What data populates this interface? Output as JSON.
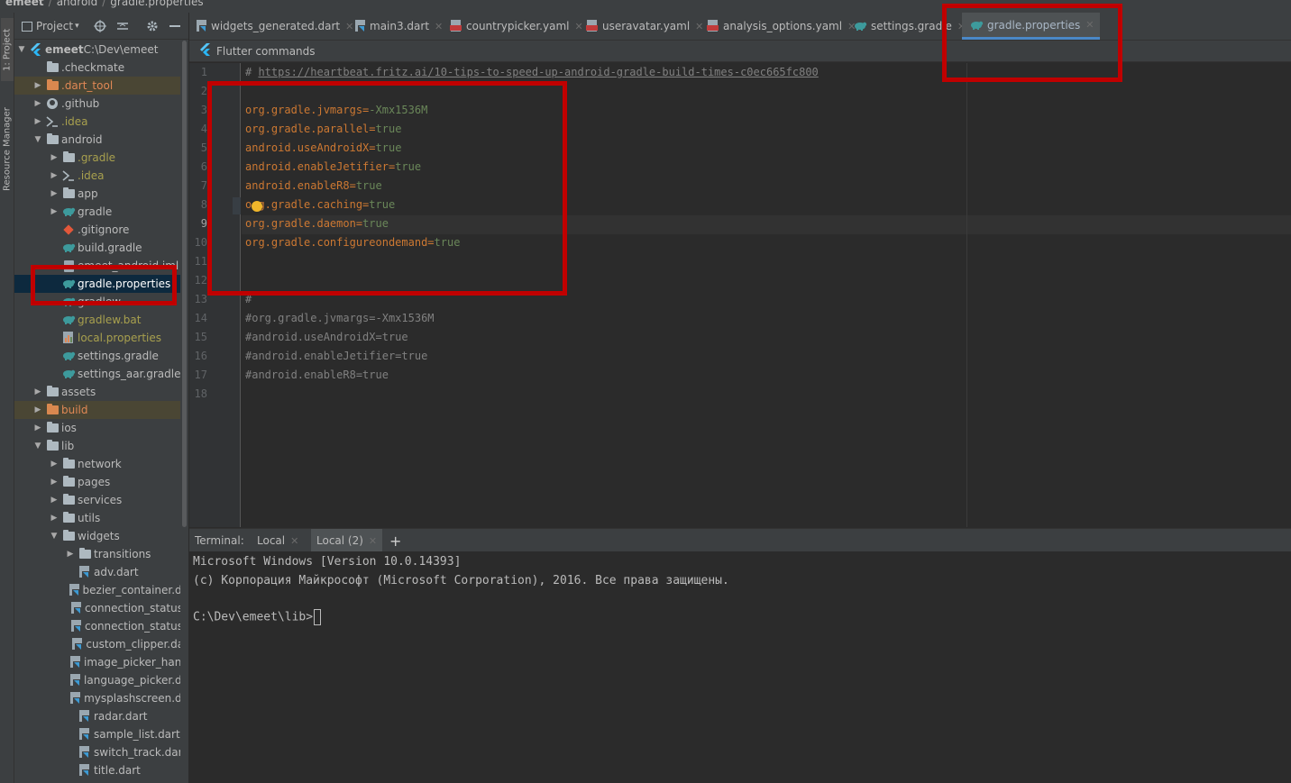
{
  "breadcrumb": [
    "emeet",
    "android",
    "gradle.properties"
  ],
  "tool_strip": {
    "project": "1: Project",
    "resource_manager": "Resource Manager"
  },
  "project_toolbar": {
    "view_label": "Project"
  },
  "tree": [
    {
      "label": "emeet",
      "path": "C:\\Dev\\emeet",
      "depth": 0,
      "arrow": "down",
      "icon": "flutter-icon",
      "bold": true
    },
    {
      "label": ".checkmate",
      "depth": 1,
      "arrow": "",
      "icon": "folder-icon"
    },
    {
      "label": ".dart_tool",
      "depth": 1,
      "arrow": "right",
      "icon": "folder-orange-icon",
      "color": "orange",
      "hl": true
    },
    {
      "label": ".github",
      "depth": 1,
      "arrow": "right",
      "icon": "github-icon"
    },
    {
      "label": ".idea",
      "depth": 1,
      "arrow": "right",
      "icon": "idea-icon",
      "color": "olive"
    },
    {
      "label": "android",
      "depth": 1,
      "arrow": "down",
      "icon": "folder-icon"
    },
    {
      "label": ".gradle",
      "depth": 2,
      "arrow": "right",
      "icon": "folder-icon",
      "color": "olive"
    },
    {
      "label": ".idea",
      "depth": 2,
      "arrow": "right",
      "icon": "idea-icon",
      "color": "olive"
    },
    {
      "label": "app",
      "depth": 2,
      "arrow": "right",
      "icon": "folder-icon"
    },
    {
      "label": "gradle",
      "depth": 2,
      "arrow": "right",
      "icon": "gradle-icon"
    },
    {
      "label": ".gitignore",
      "depth": 2,
      "arrow": "",
      "icon": "git-icon"
    },
    {
      "label": "build.gradle",
      "depth": 2,
      "arrow": "",
      "icon": "gradle-icon"
    },
    {
      "label": "emeet_android.iml",
      "depth": 2,
      "arrow": "",
      "icon": "iml-icon"
    },
    {
      "label": "gradle.properties",
      "depth": 2,
      "arrow": "",
      "icon": "gradle-icon",
      "selected": true
    },
    {
      "label": "gradlew",
      "depth": 2,
      "arrow": "",
      "icon": "gradle-icon"
    },
    {
      "label": "gradlew.bat",
      "depth": 2,
      "arrow": "",
      "icon": "gradle-icon",
      "color": "olive"
    },
    {
      "label": "local.properties",
      "depth": 2,
      "arrow": "",
      "icon": "properties-icon",
      "color": "olive"
    },
    {
      "label": "settings.gradle",
      "depth": 2,
      "arrow": "",
      "icon": "gradle-icon"
    },
    {
      "label": "settings_aar.gradle",
      "depth": 2,
      "arrow": "",
      "icon": "gradle-icon"
    },
    {
      "label": "assets",
      "depth": 1,
      "arrow": "right",
      "icon": "folder-icon"
    },
    {
      "label": "build",
      "depth": 1,
      "arrow": "right",
      "icon": "folder-orange-icon",
      "color": "orange",
      "hl": true
    },
    {
      "label": "ios",
      "depth": 1,
      "arrow": "right",
      "icon": "folder-icon"
    },
    {
      "label": "lib",
      "depth": 1,
      "arrow": "down",
      "icon": "folder-icon"
    },
    {
      "label": "network",
      "depth": 2,
      "arrow": "right",
      "icon": "folder-icon"
    },
    {
      "label": "pages",
      "depth": 2,
      "arrow": "right",
      "icon": "folder-icon"
    },
    {
      "label": "services",
      "depth": 2,
      "arrow": "right",
      "icon": "folder-icon"
    },
    {
      "label": "utils",
      "depth": 2,
      "arrow": "right",
      "icon": "folder-icon"
    },
    {
      "label": "widgets",
      "depth": 2,
      "arrow": "down",
      "icon": "folder-icon"
    },
    {
      "label": "transitions",
      "depth": 3,
      "arrow": "right",
      "icon": "folder-icon"
    },
    {
      "label": "adv.dart",
      "depth": 3,
      "arrow": "",
      "icon": "dart-file-icon"
    },
    {
      "label": "bezier_container.da",
      "depth": 3,
      "arrow": "",
      "icon": "dart-file-icon"
    },
    {
      "label": "connection_status_",
      "depth": 3,
      "arrow": "",
      "icon": "dart-file-icon"
    },
    {
      "label": "connection_status_",
      "depth": 3,
      "arrow": "",
      "icon": "dart-file-icon"
    },
    {
      "label": "custom_clipper.dar",
      "depth": 3,
      "arrow": "",
      "icon": "dart-file-icon"
    },
    {
      "label": "image_picker_hand",
      "depth": 3,
      "arrow": "",
      "icon": "dart-file-icon"
    },
    {
      "label": "language_picker.da",
      "depth": 3,
      "arrow": "",
      "icon": "dart-file-icon"
    },
    {
      "label": "mysplashscreen.da",
      "depth": 3,
      "arrow": "",
      "icon": "dart-file-icon"
    },
    {
      "label": "radar.dart",
      "depth": 3,
      "arrow": "",
      "icon": "dart-file-icon"
    },
    {
      "label": "sample_list.dart",
      "depth": 3,
      "arrow": "",
      "icon": "dart-file-icon"
    },
    {
      "label": "switch_track.dart",
      "depth": 3,
      "arrow": "",
      "icon": "dart-file-icon"
    },
    {
      "label": "title.dart",
      "depth": 3,
      "arrow": "",
      "icon": "dart-file-icon"
    }
  ],
  "editor_tabs": [
    {
      "label": "widgets_generated.dart",
      "icon": "dart-file-icon"
    },
    {
      "label": "main3.dart",
      "icon": "dart-file-icon"
    },
    {
      "label": "countrypicker.yaml",
      "icon": "yaml-icon"
    },
    {
      "label": "useravatar.yaml",
      "icon": "yaml-icon"
    },
    {
      "label": "analysis_options.yaml",
      "icon": "yaml-icon"
    },
    {
      "label": "settings.gradle",
      "icon": "gradle-icon"
    },
    {
      "label": "gradle.properties",
      "icon": "gradle-icon",
      "active": true
    }
  ],
  "flutter_bar": {
    "label": "Flutter commands"
  },
  "editor": {
    "current_line": 9,
    "lines": [
      {
        "n": "1",
        "type": "link",
        "prefix": "# ",
        "text": "https://heartbeat.fritz.ai/10-tips-to-speed-up-android-gradle-build-times-c0ec665fc800"
      },
      {
        "n": "2",
        "type": "blank"
      },
      {
        "n": "3",
        "type": "prop",
        "key": "org.gradle.jvmargs",
        "value": "-Xmx1536M"
      },
      {
        "n": "4",
        "type": "prop",
        "key": "org.gradle.parallel",
        "value": "true"
      },
      {
        "n": "5",
        "type": "prop",
        "key": "android.useAndroidX",
        "value": "true"
      },
      {
        "n": "6",
        "type": "prop",
        "key": "android.enableJetifier",
        "value": "true"
      },
      {
        "n": "7",
        "type": "prop",
        "key": "android.enableR8",
        "value": "true"
      },
      {
        "n": "8",
        "type": "prop",
        "key": "org.gradle.caching",
        "value": "true"
      },
      {
        "n": "9",
        "type": "prop",
        "key": "org.gradle.daemon",
        "value": "true"
      },
      {
        "n": "10",
        "type": "prop",
        "key": "org.gradle.configureondemand",
        "value": "true"
      },
      {
        "n": "11",
        "type": "blank"
      },
      {
        "n": "12",
        "type": "blank"
      },
      {
        "n": "13",
        "type": "comment",
        "text": "#"
      },
      {
        "n": "14",
        "type": "comment",
        "text": "#org.gradle.jvmargs=-Xmx1536M"
      },
      {
        "n": "15",
        "type": "comment",
        "text": "#android.useAndroidX=true"
      },
      {
        "n": "16",
        "type": "comment",
        "text": "#android.enableJetifier=true"
      },
      {
        "n": "17",
        "type": "comment",
        "text": "#android.enableR8=true"
      },
      {
        "n": "18",
        "type": "blank"
      }
    ]
  },
  "terminal": {
    "title": "Terminal:",
    "tabs": [
      {
        "label": "Local",
        "active": false
      },
      {
        "label": "Local (2)",
        "active": true
      }
    ],
    "add_label": "+",
    "lines": [
      "Microsoft Windows [Version 10.0.14393]",
      "(c) Корпорация Майкрософт (Microsoft Corporation), 2016. Все права защищены.",
      "",
      "C:\\Dev\\emeet\\lib>"
    ]
  },
  "colors": {
    "accent": "#4a88c7",
    "highlight_box": "#c00000",
    "key": "#cc7832",
    "value": "#6a8759",
    "comment": "#808080"
  }
}
